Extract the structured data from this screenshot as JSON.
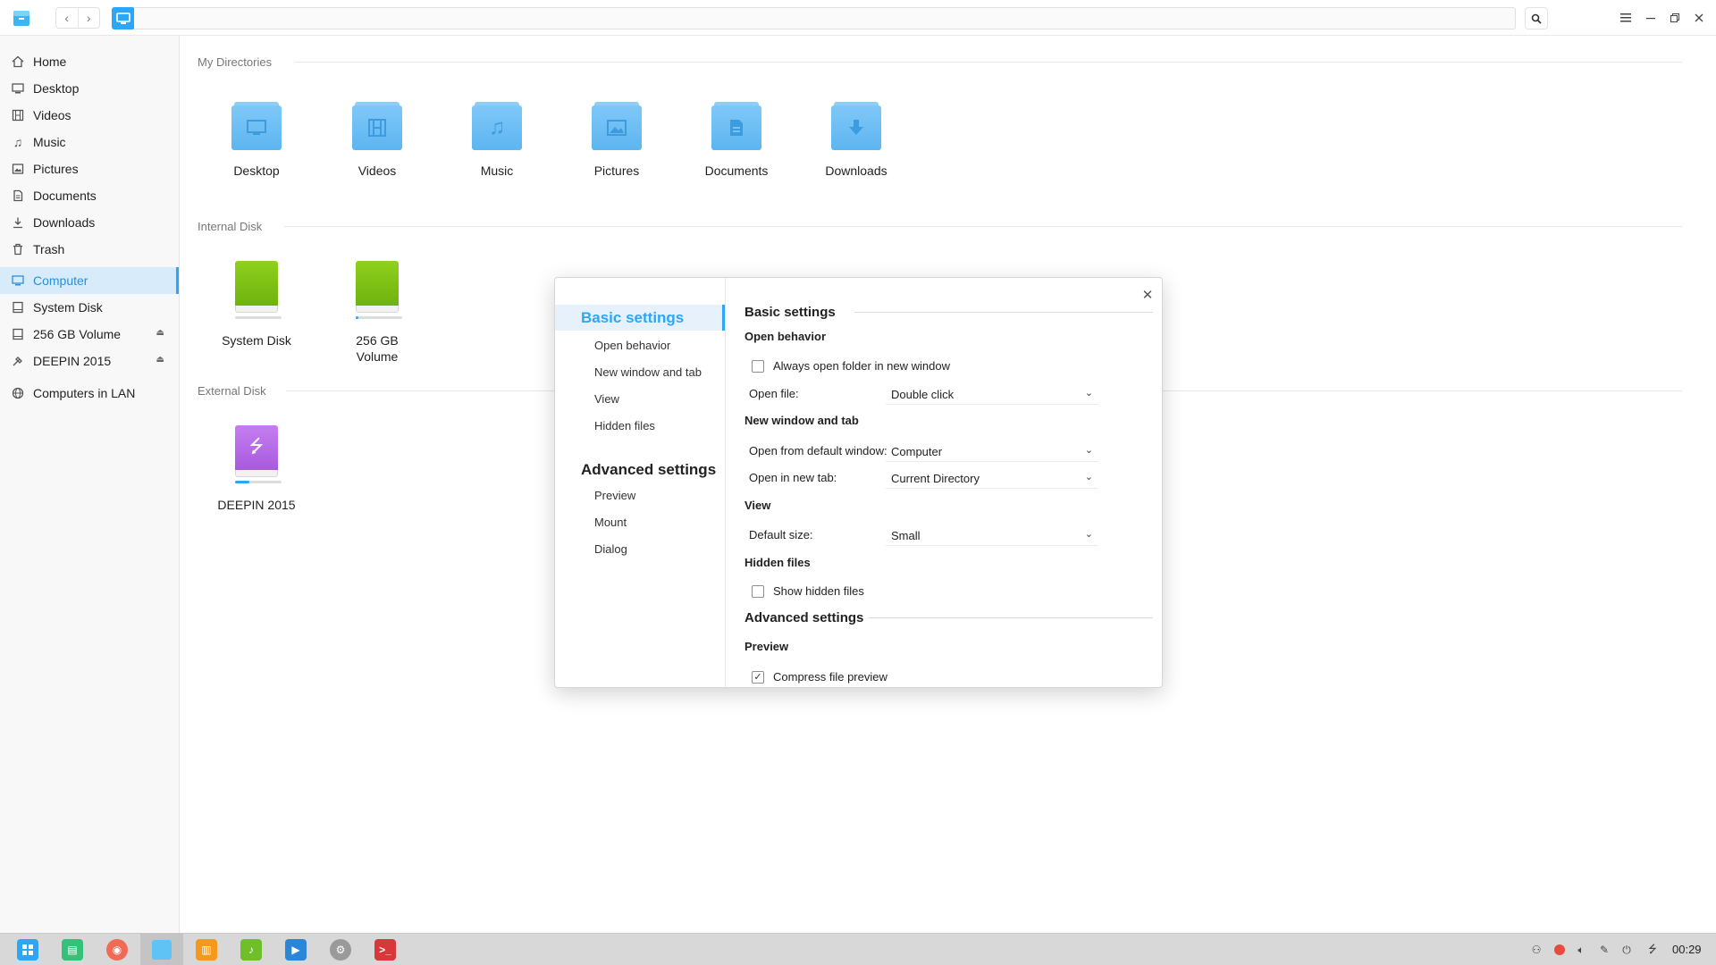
{
  "sidebar": {
    "items": [
      {
        "label": "Home",
        "icon": "home-icon"
      },
      {
        "label": "Desktop",
        "icon": "desktop-icon"
      },
      {
        "label": "Videos",
        "icon": "videos-icon"
      },
      {
        "label": "Music",
        "icon": "music-icon"
      },
      {
        "label": "Pictures",
        "icon": "pictures-icon"
      },
      {
        "label": "Documents",
        "icon": "documents-icon"
      },
      {
        "label": "Downloads",
        "icon": "downloads-icon"
      },
      {
        "label": "Trash",
        "icon": "trash-icon"
      }
    ],
    "devices": [
      {
        "label": "Computer",
        "icon": "computer-icon",
        "active": true
      },
      {
        "label": "System Disk",
        "icon": "disk-icon"
      },
      {
        "label": "256 GB Volume",
        "icon": "disk-icon",
        "ejectable": true
      },
      {
        "label": "DEEPIN 2015",
        "icon": "usb-icon",
        "ejectable": true
      }
    ],
    "network": {
      "label": "Computers in LAN",
      "icon": "network-icon"
    }
  },
  "main": {
    "sections": {
      "my_dirs": "My Directories",
      "internal": "Internal Disk",
      "external": "External Disk"
    },
    "directories": [
      "Desktop",
      "Videos",
      "Music",
      "Pictures",
      "Documents",
      "Downloads"
    ],
    "internal_disks": [
      {
        "name": "System Disk",
        "usage": 0.0
      },
      {
        "name": "256 GB Volume",
        "usage": 0.05
      }
    ],
    "external_disks": [
      {
        "name": "DEEPIN 2015",
        "usage": 0.3
      }
    ]
  },
  "dialog": {
    "nav": {
      "basic": "Basic settings",
      "basic_items": [
        "Open behavior",
        "New window and tab",
        "View",
        "Hidden files"
      ],
      "advanced": "Advanced settings",
      "advanced_items": [
        "Preview",
        "Mount",
        "Dialog"
      ]
    },
    "content": {
      "basic_title": "Basic settings",
      "open_behavior": "Open behavior",
      "always_open_label": "Always open folder in new window",
      "always_open_checked": false,
      "open_file_label": "Open file:",
      "open_file_value": "Double click",
      "new_window_title": "New window and tab",
      "open_default_label": "Open from default window:",
      "open_default_value": "Computer",
      "open_new_tab_label": "Open in new tab:",
      "open_new_tab_value": "Current Directory",
      "view_title": "View",
      "default_size_label": "Default size:",
      "default_size_value": "Small",
      "hidden_title": "Hidden files",
      "show_hidden_label": "Show hidden files",
      "show_hidden_checked": false,
      "advanced_title": "Advanced settings",
      "preview_title": "Preview",
      "compress_label": "Compress file preview",
      "compress_checked": true
    }
  },
  "dock": {
    "apps": [
      "launcher-icon",
      "deepin-store-icon",
      "music-player-icon",
      "file-manager-icon",
      "archive-icon",
      "wps-icon",
      "video-player-icon",
      "settings-icon",
      "terminal-icon"
    ],
    "clock": "00:29"
  },
  "colors": {
    "accent": "#2ca7f8",
    "folder": "#6cbef5",
    "disk_green": "#7dc313",
    "usb_purple": "#b56ae6"
  }
}
